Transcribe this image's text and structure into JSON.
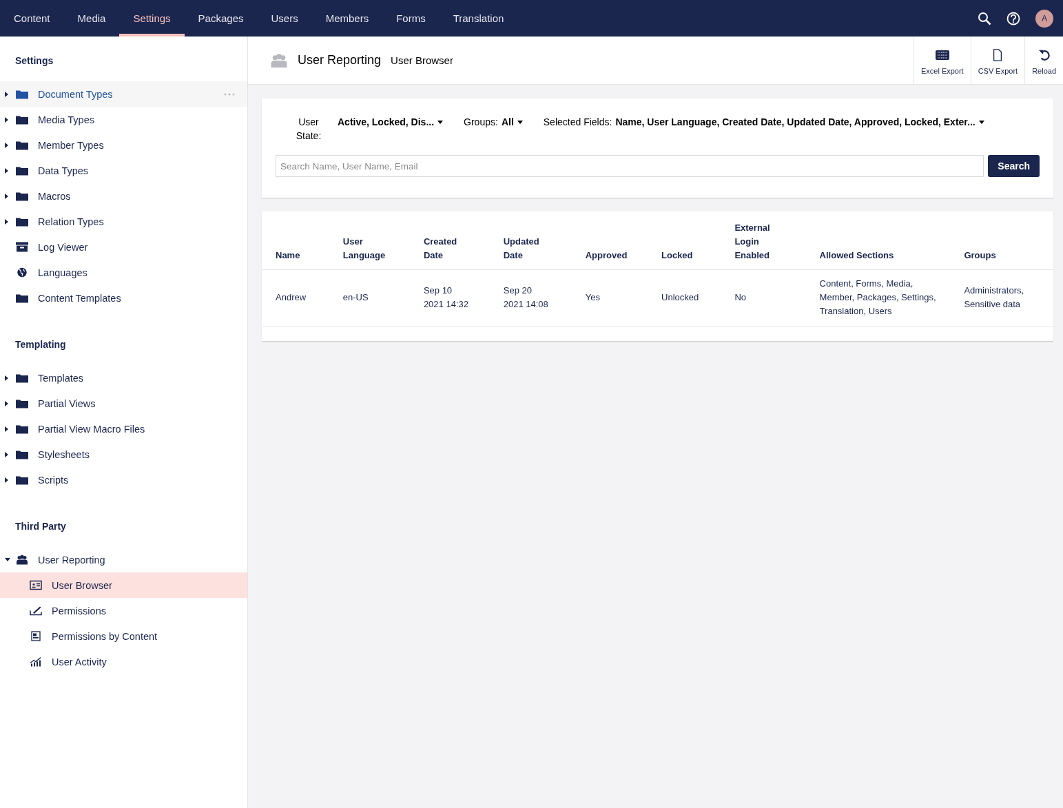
{
  "top_nav": {
    "tabs": [
      {
        "label": "Content",
        "selected": false
      },
      {
        "label": "Media",
        "selected": false
      },
      {
        "label": "Settings",
        "selected": true
      },
      {
        "label": "Packages",
        "selected": false
      },
      {
        "label": "Users",
        "selected": false
      },
      {
        "label": "Members",
        "selected": false
      },
      {
        "label": "Forms",
        "selected": false
      },
      {
        "label": "Translation",
        "selected": false
      }
    ],
    "avatar": "A"
  },
  "sidebar": {
    "sections": [
      {
        "title": "Settings",
        "items": [
          {
            "label": "Document Types",
            "kind": "folder",
            "expandable": true,
            "expanded": false,
            "selected": false,
            "highlighted": true
          },
          {
            "label": "Media Types",
            "kind": "folder",
            "expandable": true,
            "expanded": false,
            "selected": false,
            "highlighted": false
          },
          {
            "label": "Member Types",
            "kind": "folder",
            "expandable": true,
            "expanded": false,
            "selected": false,
            "highlighted": false
          },
          {
            "label": "Data Types",
            "kind": "folder",
            "expandable": true,
            "expanded": false,
            "selected": false,
            "highlighted": false
          },
          {
            "label": "Macros",
            "kind": "folder",
            "expandable": true,
            "expanded": false,
            "selected": false,
            "highlighted": false
          },
          {
            "label": "Relation Types",
            "kind": "folder",
            "expandable": true,
            "expanded": false,
            "selected": false,
            "highlighted": false
          },
          {
            "label": "Log Viewer",
            "kind": "archive",
            "expandable": false,
            "selected": false,
            "highlighted": false
          },
          {
            "label": "Languages",
            "kind": "globe",
            "expandable": false,
            "selected": false,
            "highlighted": false
          },
          {
            "label": "Content Templates",
            "kind": "folder",
            "expandable": false,
            "selected": false,
            "highlighted": false
          }
        ]
      },
      {
        "title": "Templating",
        "items": [
          {
            "label": "Templates",
            "kind": "folder",
            "expandable": true,
            "expanded": false,
            "selected": false,
            "highlighted": false
          },
          {
            "label": "Partial Views",
            "kind": "folder",
            "expandable": true,
            "expanded": false,
            "selected": false,
            "highlighted": false
          },
          {
            "label": "Partial View Macro Files",
            "kind": "folder",
            "expandable": true,
            "expanded": false,
            "selected": false,
            "highlighted": false
          },
          {
            "label": "Stylesheets",
            "kind": "folder",
            "expandable": true,
            "expanded": false,
            "selected": false,
            "highlighted": false
          },
          {
            "label": "Scripts",
            "kind": "folder",
            "expandable": true,
            "expanded": false,
            "selected": false,
            "highlighted": false
          }
        ]
      },
      {
        "title": "Third Party",
        "items": [
          {
            "label": "User Reporting",
            "kind": "people",
            "expandable": true,
            "expanded": true,
            "selected": false,
            "highlighted": false,
            "children": [
              {
                "label": "User Browser",
                "kind": "id-card",
                "selected": true
              },
              {
                "label": "Permissions",
                "kind": "edit",
                "selected": false
              },
              {
                "label": "Permissions by Content",
                "kind": "document",
                "selected": false
              },
              {
                "label": "User Activity",
                "kind": "chart",
                "selected": false
              }
            ]
          }
        ]
      }
    ]
  },
  "header": {
    "title": "User Reporting",
    "subtitle": "User Browser",
    "actions": [
      {
        "label": "Excel Export",
        "kind": "binary"
      },
      {
        "label": "CSV Export",
        "kind": "file"
      },
      {
        "label": "Reload",
        "kind": "reload"
      }
    ]
  },
  "filters": {
    "user_state_label": "User State:",
    "user_state_value": "Active, Locked, Dis...",
    "groups_label": "Groups:",
    "groups_value": "All",
    "fields_label": "Selected Fields:",
    "fields_value": "Name, User Language, Created Date, Updated Date, Approved, Locked, Exter...",
    "search_placeholder": "Search Name, User Name, Email",
    "search_button": "Search"
  },
  "table": {
    "columns": [
      "Name",
      "User\nLanguage",
      "Created\nDate",
      "Updated\nDate",
      "Approved",
      "Locked",
      "External\nLogin\nEnabled",
      "Allowed Sections",
      "Groups"
    ],
    "rows": [
      [
        "Andrew",
        "en-US",
        "Sep 10\n2021 14:32",
        "Sep 20\n2021 14:08",
        "Yes",
        "Unlocked",
        "No",
        "Content, Forms, Media,\nMember, Packages, Settings,\nTranslation, Users",
        "Administrators,\nSensitive data"
      ]
    ]
  }
}
